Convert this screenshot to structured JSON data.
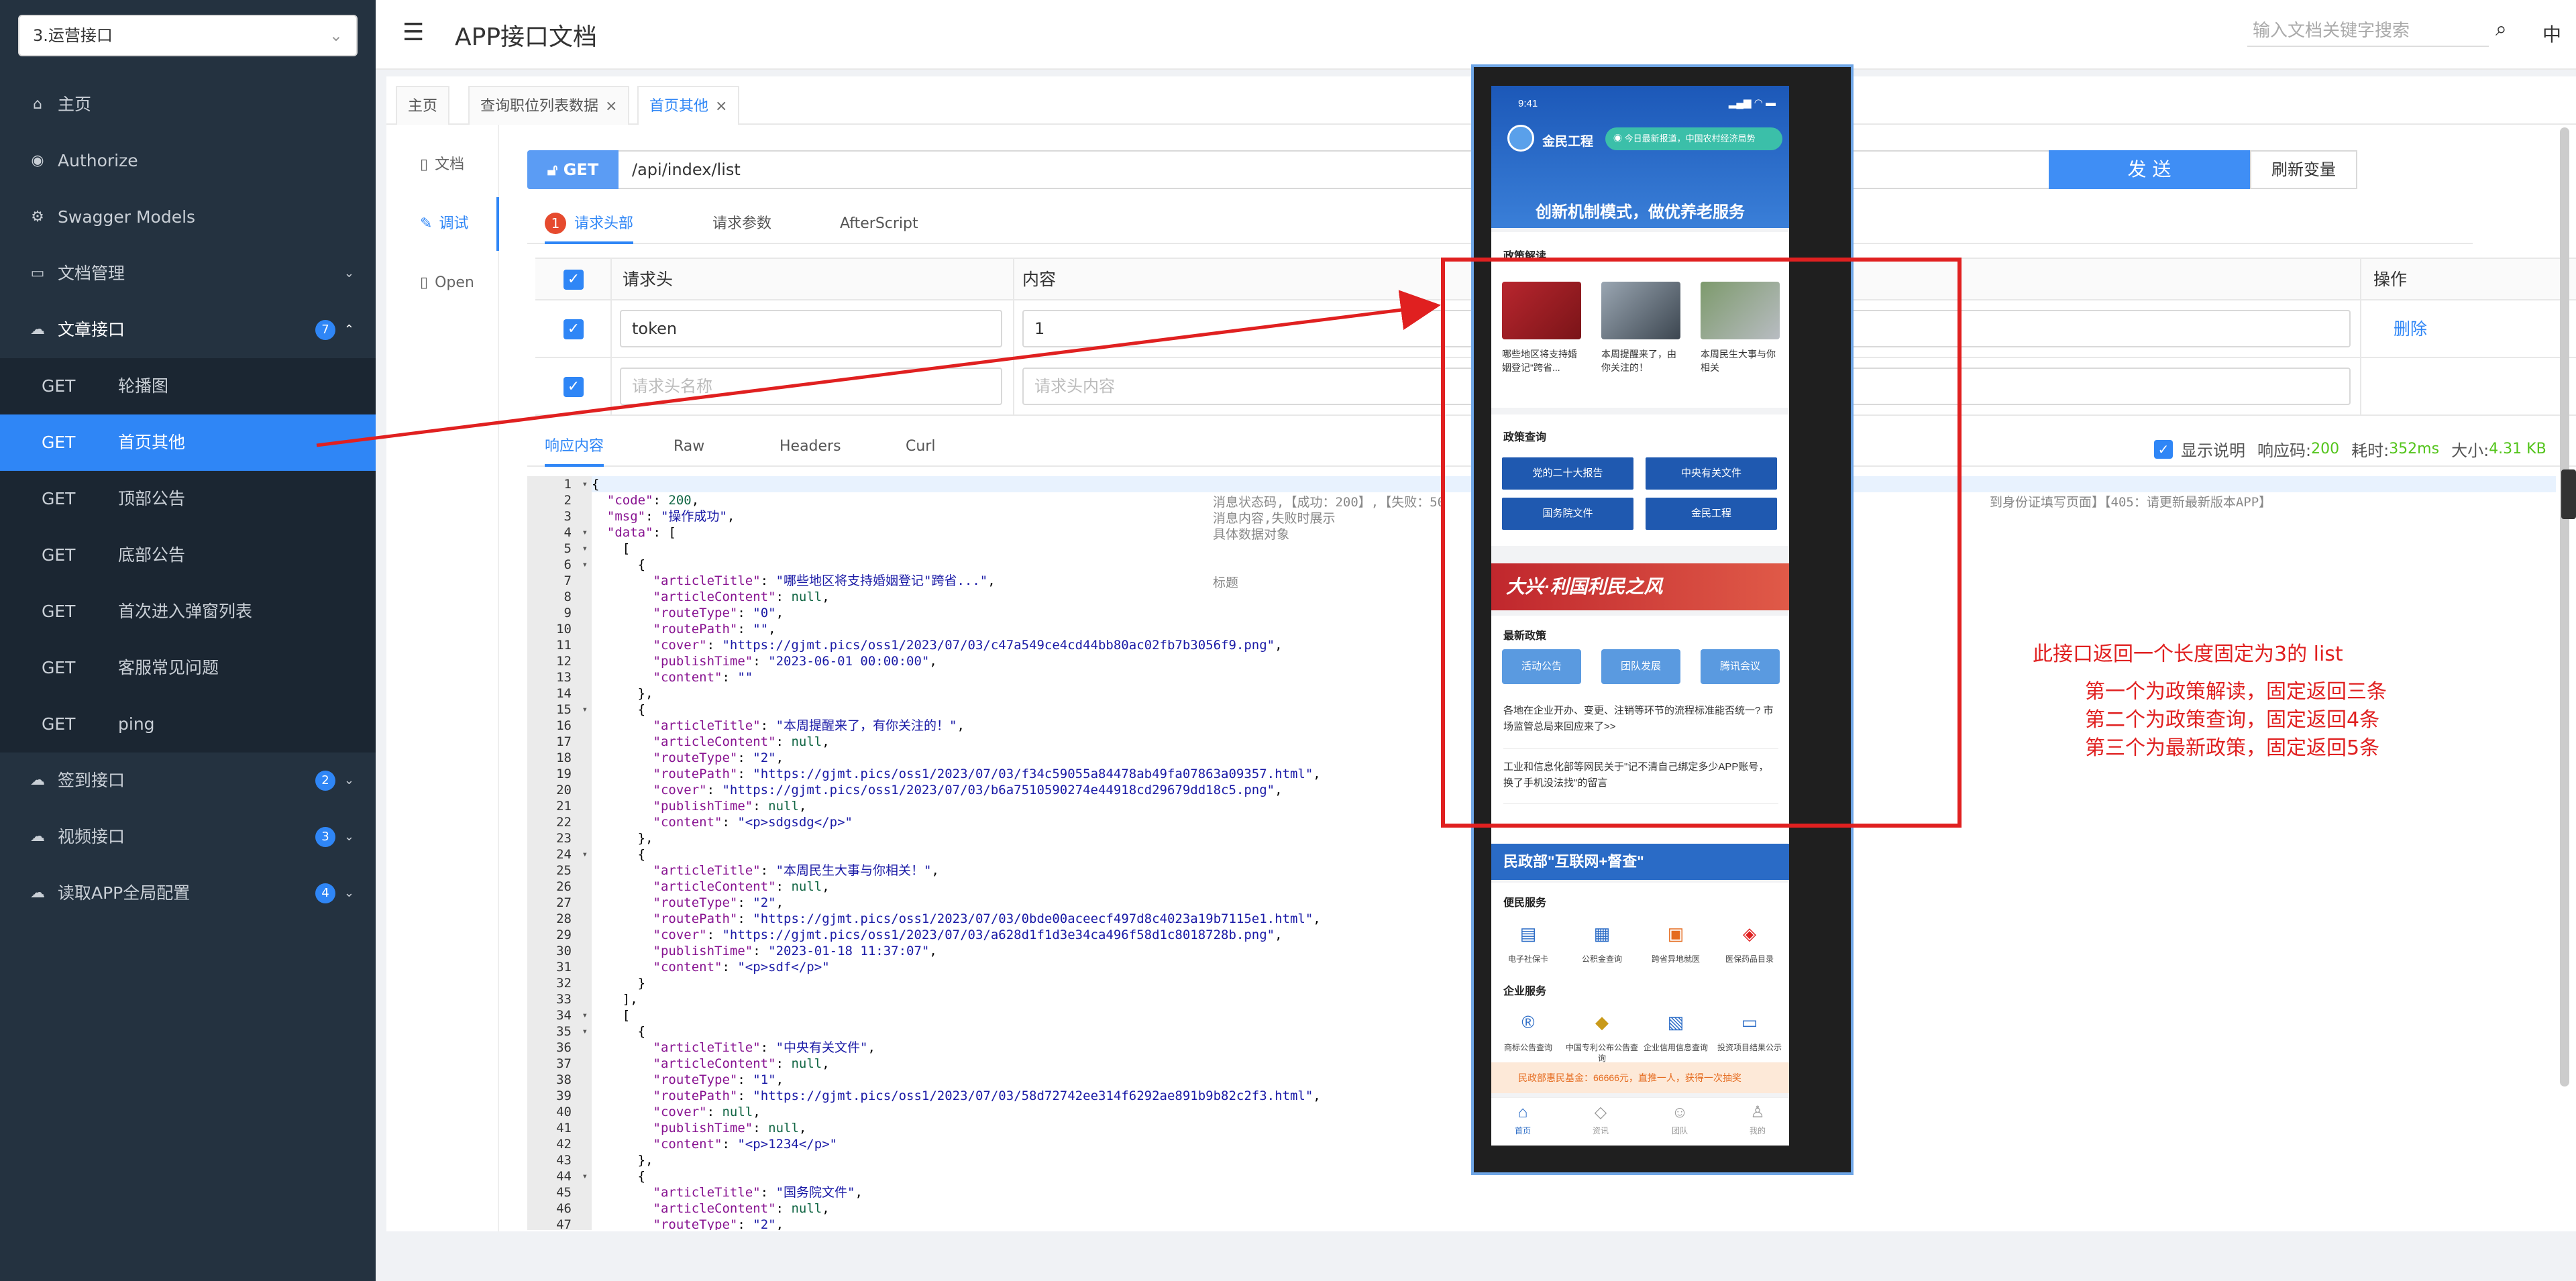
{
  "sidebar": {
    "selector": "3.运营接口",
    "items": [
      {
        "label": "主页"
      },
      {
        "label": "Authorize"
      },
      {
        "label": "Swagger Models"
      },
      {
        "label": "文档管理"
      }
    ],
    "group": {
      "label": "文章接口",
      "badge": "7"
    },
    "sub": [
      {
        "m": "GET",
        "label": "轮播图"
      },
      {
        "m": "GET",
        "label": "首页其他"
      },
      {
        "m": "GET",
        "label": "顶部公告"
      },
      {
        "m": "GET",
        "label": "底部公告"
      },
      {
        "m": "GET",
        "label": "首次进入弹窗列表"
      },
      {
        "m": "GET",
        "label": "客服常见问题"
      },
      {
        "m": "GET",
        "label": "ping"
      }
    ],
    "groups2": [
      {
        "label": "签到接口",
        "badge": "2"
      },
      {
        "label": "视频接口",
        "badge": "3"
      },
      {
        "label": "读取APP全局配置",
        "badge": "4"
      }
    ]
  },
  "header": {
    "title": "APP接口文档",
    "search_placeholder": "输入文档关键字搜索",
    "lang": "中"
  },
  "tabs": [
    "主页",
    "查询职位列表数据",
    "首页其他"
  ],
  "vnav": [
    "文档",
    "调试",
    "Open"
  ],
  "request": {
    "method": "GET",
    "path": "/api/index/list",
    "send": "发 送",
    "refresh": "刷新变量",
    "tabs": [
      "请求头部",
      "请求参数",
      "AfterScript"
    ],
    "badge": "1"
  },
  "headers_table": {
    "col_header": "请求头",
    "col_content": "内容",
    "col_op": "操作",
    "row_key": "token",
    "row_value": "1",
    "delete": "删除",
    "ph_key": "请求头名称",
    "ph_value": "请求头内容"
  },
  "response": {
    "tabs": [
      "响应内容",
      "Raw",
      "Headers",
      "Curl"
    ],
    "show_desc": "显示说明",
    "code_label": "响应码:",
    "code": "200",
    "time_label": "耗时:",
    "time": "352ms",
    "size_label": "大小:",
    "size": "4.31 KB"
  },
  "code_lines": [
    "{",
    "  \"code\": 200,",
    "  \"msg\": \"操作成功\",",
    "  \"data\": [",
    "    [",
    "      {",
    "        \"articleTitle\": \"哪些地区将支持婚姻登记\"跨省...\",",
    "        \"articleContent\": null,",
    "        \"routeType\": \"0\",",
    "        \"routePath\": \"\",",
    "        \"cover\": \"https://gjmt.pics/oss1/2023/07/03/c47a549ce4cd44bb80ac02fb7b3056f9.png\",",
    "        \"publishTime\": \"2023-06-01 00:00:00\",",
    "        \"content\": \"\"",
    "      },",
    "      {",
    "        \"articleTitle\": \"本周提醒来了，有你关注的！\",",
    "        \"articleContent\": null,",
    "        \"routeType\": \"2\",",
    "        \"routePath\": \"https://gjmt.pics/oss1/2023/07/03/f34c59055a84478ab49fa07863a09357.html\",",
    "        \"cover\": \"https://gjmt.pics/oss1/2023/07/03/b6a7510590274e44918cd29679dd18c5.png\",",
    "        \"publishTime\": null,",
    "        \"content\": \"<p>sdgsdg</p>\"",
    "      },",
    "      {",
    "        \"articleTitle\": \"本周民生大事与你相关！\",",
    "        \"articleContent\": null,",
    "        \"routeType\": \"2\",",
    "        \"routePath\": \"https://gjmt.pics/oss1/2023/07/03/0bde00aceecf497d8c4023a19b7115e1.html\",",
    "        \"cover\": \"https://gjmt.pics/oss1/2023/07/03/a628d1f1d3e34ca496f58d1c8018728b.png\",",
    "        \"publishTime\": \"2023-01-18 11:37:07\",",
    "        \"content\": \"<p>sdf</p>\"",
    "      }",
    "    ],",
    "    [",
    "      {",
    "        \"articleTitle\": \"中央有关文件\",",
    "        \"articleContent\": null,",
    "        \"routeType\": \"1\",",
    "        \"routePath\": \"https://gjmt.pics/oss1/2023/07/03/58d72742ee314f6292ae891b9b82c2f3.html\",",
    "        \"cover\": null,",
    "        \"publishTime\": null,",
    "        \"content\": \"<p>1234</p>\"",
    "      },",
    "      {",
    "        \"articleTitle\": \"国务院文件\",",
    "        \"articleContent\": null,",
    "        \"routeType\": \"2\","
  ],
  "code_comments": {
    "c1": "消息状态码,【成功：200】,【失败：50",
    "c1b": "到身份证填写页面】【405：请更新最新版本APP】",
    "c2": "消息内容,失败时展示",
    "c3": "具体数据对象",
    "c6": "标题"
  },
  "phone": {
    "time": "9:41",
    "brand": "金民工程",
    "notice": "今日最新报道，中国农村经济局势",
    "slogan": "创新机制模式，做优养老服务",
    "s1_title": "政策解读",
    "captions": [
      "哪些地区将支持婚姻登记\"跨省...",
      "本周提醒来了，由你关注的！",
      "本周民生大事与你相关"
    ],
    "s2_title": "政策查询",
    "s2_buttons": [
      "党的二十大报告",
      "中央有关文件",
      "国务院文件",
      "金民工程"
    ],
    "banner": "大兴·利国利民之风",
    "s3_title": "最新政策",
    "s3_buttons": [
      "活动公告",
      "团队发展",
      "腾讯会议"
    ],
    "news": [
      "各地在企业开办、变更、注销等环节的流程标准能否统一? 市场监管总局来回应来了>>",
      "工业和信息化部等网民关于\"记不清自己绑定多少APP账号，换了手机没法找\"的留言"
    ],
    "bluebar": "民政部\"互联网+督查\"",
    "svc_title": "便民服务",
    "svc": [
      "电子社保卡",
      "公积金查询",
      "跨省异地就医",
      "医保药品目录"
    ],
    "ent_title": "企业服务",
    "ent": [
      "商标公告查询",
      "中国专利公布公告查询",
      "企业信用信息查询",
      "投资项目结果公示"
    ],
    "ticker": "民政部惠民基金：66666元，直推一人，获得一次抽奖",
    "tabbar": [
      "首页",
      "资讯",
      "团队",
      "我的"
    ]
  },
  "annotation": {
    "title": "此接口返回一个长度固定为3的 list",
    "lines": [
      "第一个为政策解读，固定返回三条",
      "第二个为政策查询，固定返回4条",
      "第三个为最新政策，固定返回5条"
    ]
  },
  "colors": {
    "accent": "#2f86f6",
    "sidebar": "#243240",
    "red": "#e02020"
  }
}
